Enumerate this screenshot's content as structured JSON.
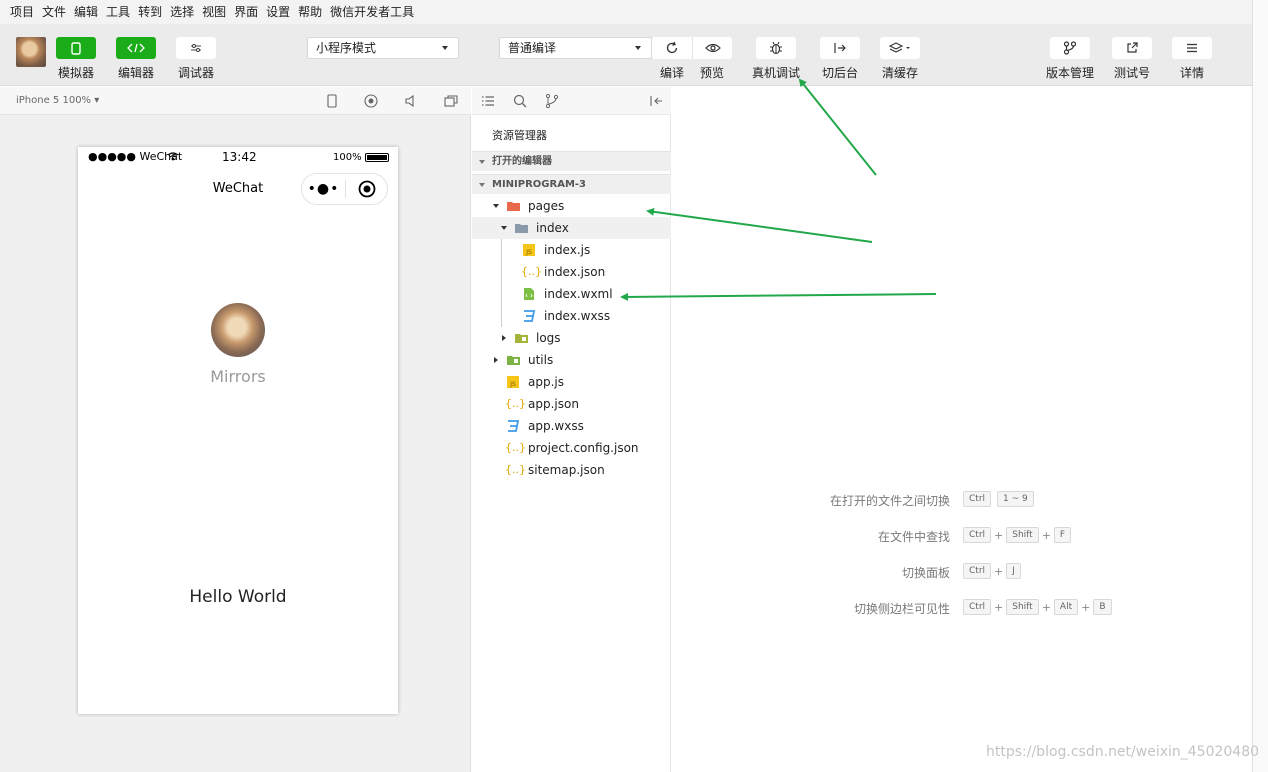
{
  "menu": [
    "项目",
    "文件",
    "编辑",
    "工具",
    "转到",
    "选择",
    "视图",
    "界面",
    "设置",
    "帮助",
    "微信开发者工具"
  ],
  "toolbar": {
    "simulator_label": "模拟器",
    "editor_label": "编辑器",
    "debugger_label": "调试器",
    "mode_select": "小程序模式",
    "compile_select": "普通编译",
    "compile_label": "编译",
    "preview_label": "预览",
    "remote_debug_label": "真机调试",
    "background_label": "切后台",
    "clear_cache_label": "清缓存",
    "version_label": "版本管理",
    "test_account_label": "测试号",
    "details_label": "详情"
  },
  "simulator": {
    "device": "iPhone 5 100% ▾",
    "status": {
      "signal": "●●●●● WeChat",
      "time": "13:42",
      "battery": "100%"
    },
    "nav_title": "WeChat",
    "capsule_dots": "•●•",
    "user_name": "Mirrors",
    "hello": "Hello World"
  },
  "explorer": {
    "title": "资源管理器",
    "open_editors": "打开的编辑器",
    "project": "MINIPROGRAM-3",
    "tree": {
      "pages": "pages",
      "index": "index",
      "index_js": "index.js",
      "index_json": "index.json",
      "index_wxml": "index.wxml",
      "index_wxss": "index.wxss",
      "logs": "logs",
      "utils": "utils",
      "app_js": "app.js",
      "app_json": "app.json",
      "app_wxss": "app.wxss",
      "project_config": "project.config.json",
      "sitemap": "sitemap.json"
    }
  },
  "shortcuts": [
    {
      "desc": "在打开的文件之间切换",
      "keys": [
        "Ctrl",
        "1 ~ 9"
      ],
      "joiner": ""
    },
    {
      "desc": "在文件中查找",
      "keys": [
        "Ctrl",
        "Shift",
        "F"
      ],
      "joiner": "+"
    },
    {
      "desc": "切换面板",
      "keys": [
        "Ctrl",
        "J"
      ],
      "joiner": "+"
    },
    {
      "desc": "切换侧边栏可见性",
      "keys": [
        "Ctrl",
        "Shift",
        "Alt",
        "B"
      ],
      "joiner": "+"
    }
  ],
  "watermark": "https://blog.csdn.net/weixin_45020480",
  "colors": {
    "accent_green": "#1aad19",
    "arrow_green": "#22a84a"
  }
}
